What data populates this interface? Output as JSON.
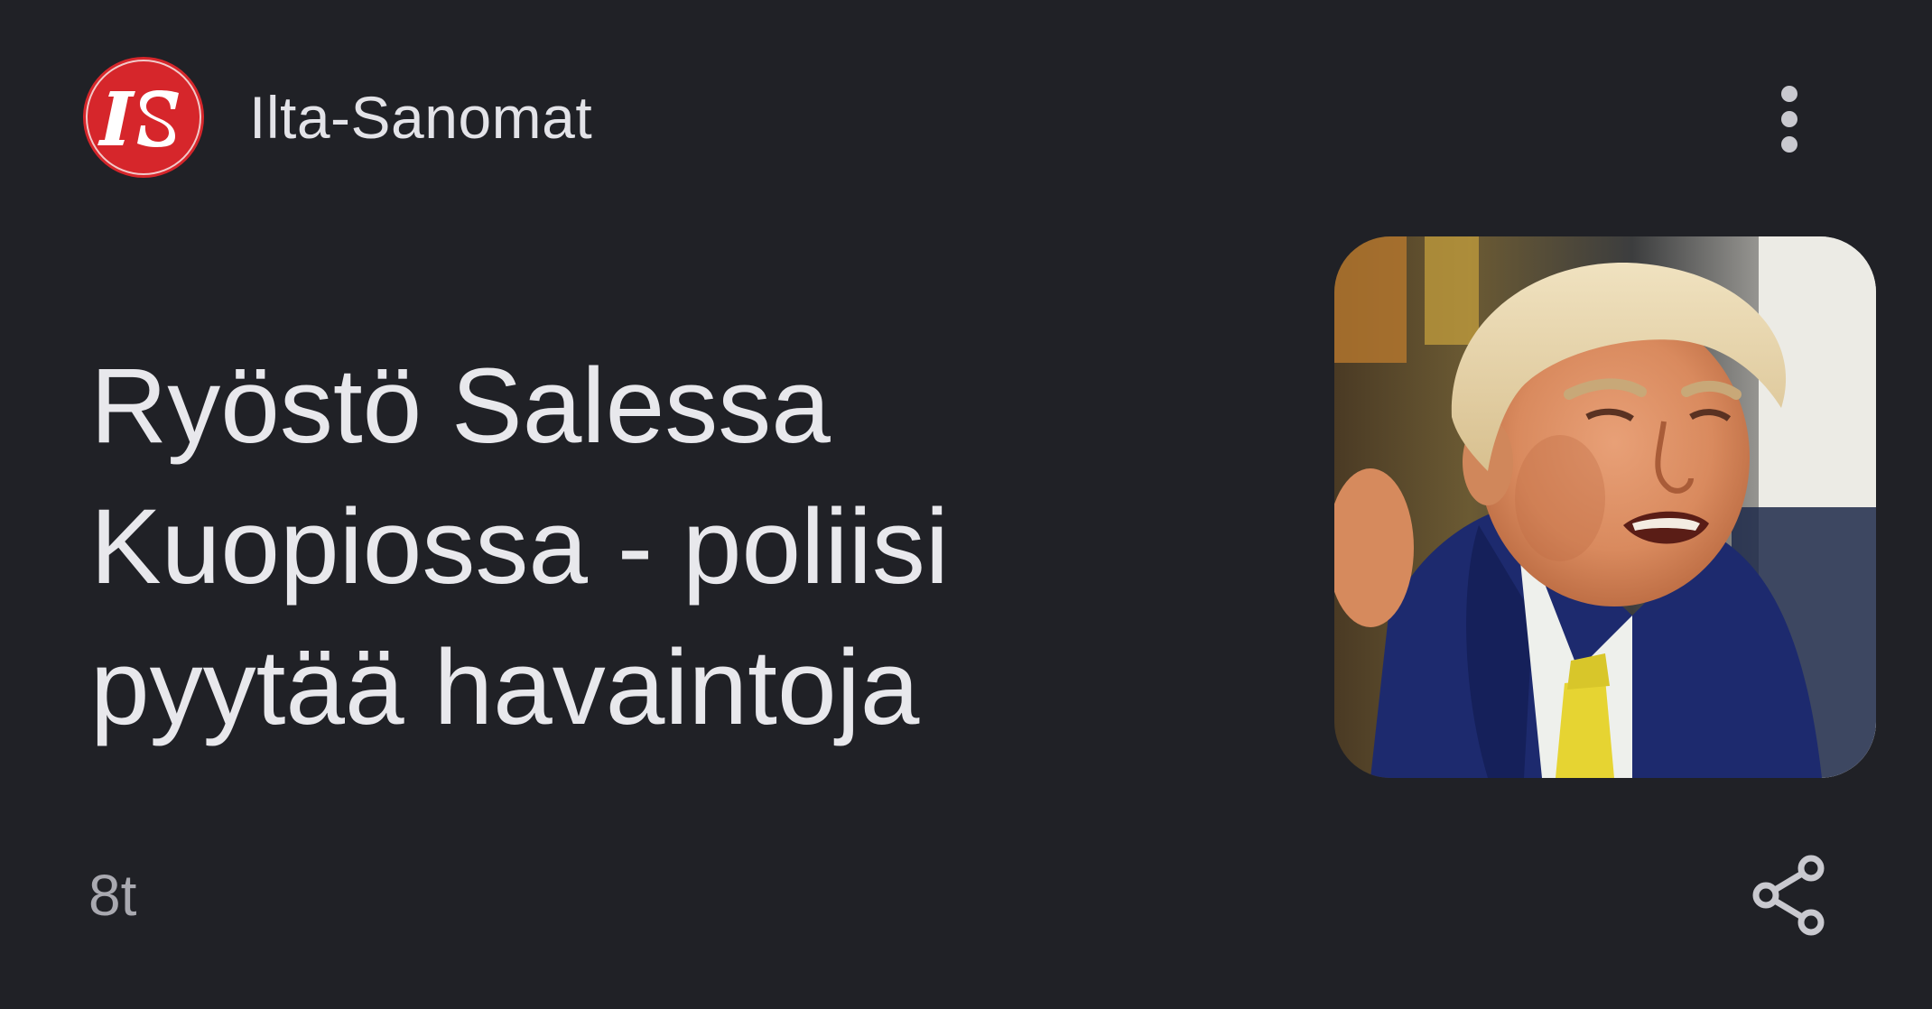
{
  "source": {
    "logo_text": "IS",
    "name": "Ilta-Sanomat",
    "logo_color": "#d6262b"
  },
  "article": {
    "headline": "Ryöstö Salessa Kuopiossa - poliisi pyytää havaintoja",
    "time_ago": "8t"
  },
  "icons": {
    "menu": "more-vertical-icon",
    "share": "share-icon"
  },
  "colors": {
    "background": "#202126",
    "headline_text": "#e8e8ec",
    "meta_text": "#a9a9b0"
  }
}
